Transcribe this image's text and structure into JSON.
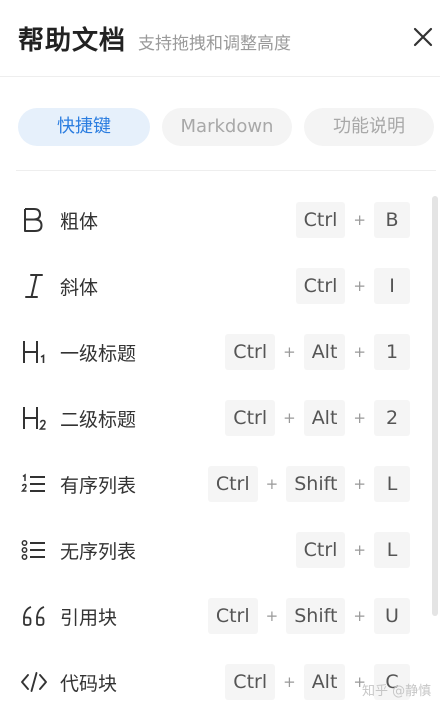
{
  "header": {
    "title": "帮助文档",
    "subtitle": "支持拖拽和调整高度"
  },
  "tabs": [
    {
      "label": "快捷键",
      "active": true
    },
    {
      "label": "Markdown",
      "active": false
    },
    {
      "label": "功能说明",
      "active": false
    }
  ],
  "shortcuts": [
    {
      "icon": "bold-icon",
      "label": "粗体",
      "keys": [
        "Ctrl",
        "B"
      ]
    },
    {
      "icon": "italic-icon",
      "label": "斜体",
      "keys": [
        "Ctrl",
        "I"
      ]
    },
    {
      "icon": "heading-1-icon",
      "label": "一级标题",
      "keys": [
        "Ctrl",
        "Alt",
        "1"
      ]
    },
    {
      "icon": "heading-2-icon",
      "label": "二级标题",
      "keys": [
        "Ctrl",
        "Alt",
        "2"
      ]
    },
    {
      "icon": "ordered-list-icon",
      "label": "有序列表",
      "keys": [
        "Ctrl",
        "Shift",
        "L"
      ]
    },
    {
      "icon": "unordered-list-icon",
      "label": "无序列表",
      "keys": [
        "Ctrl",
        "L"
      ]
    },
    {
      "icon": "quote-icon",
      "label": "引用块",
      "keys": [
        "Ctrl",
        "Shift",
        "U"
      ]
    },
    {
      "icon": "code-icon",
      "label": "代码块",
      "keys": [
        "Ctrl",
        "Alt",
        "C"
      ]
    }
  ],
  "key_separator": "+",
  "watermark": "知乎 @静慎"
}
